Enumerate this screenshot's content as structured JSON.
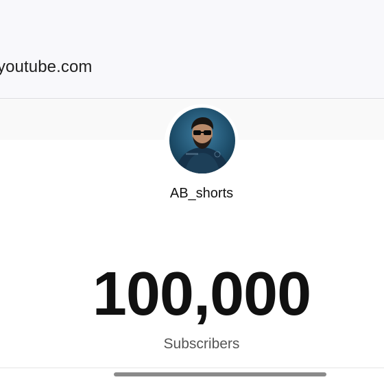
{
  "browser": {
    "url": "youtube.com"
  },
  "channel": {
    "avatar_icon": "channel-avatar-photo",
    "name": "AB_shorts"
  },
  "stats": {
    "subscriber_count": "100,000",
    "subscriber_label": "Subscribers"
  },
  "colors": {
    "url_bar_bg": "#f8f8fb",
    "avatar_bg": "#1e4f6c",
    "text": "#111111",
    "label_text": "#555555"
  }
}
